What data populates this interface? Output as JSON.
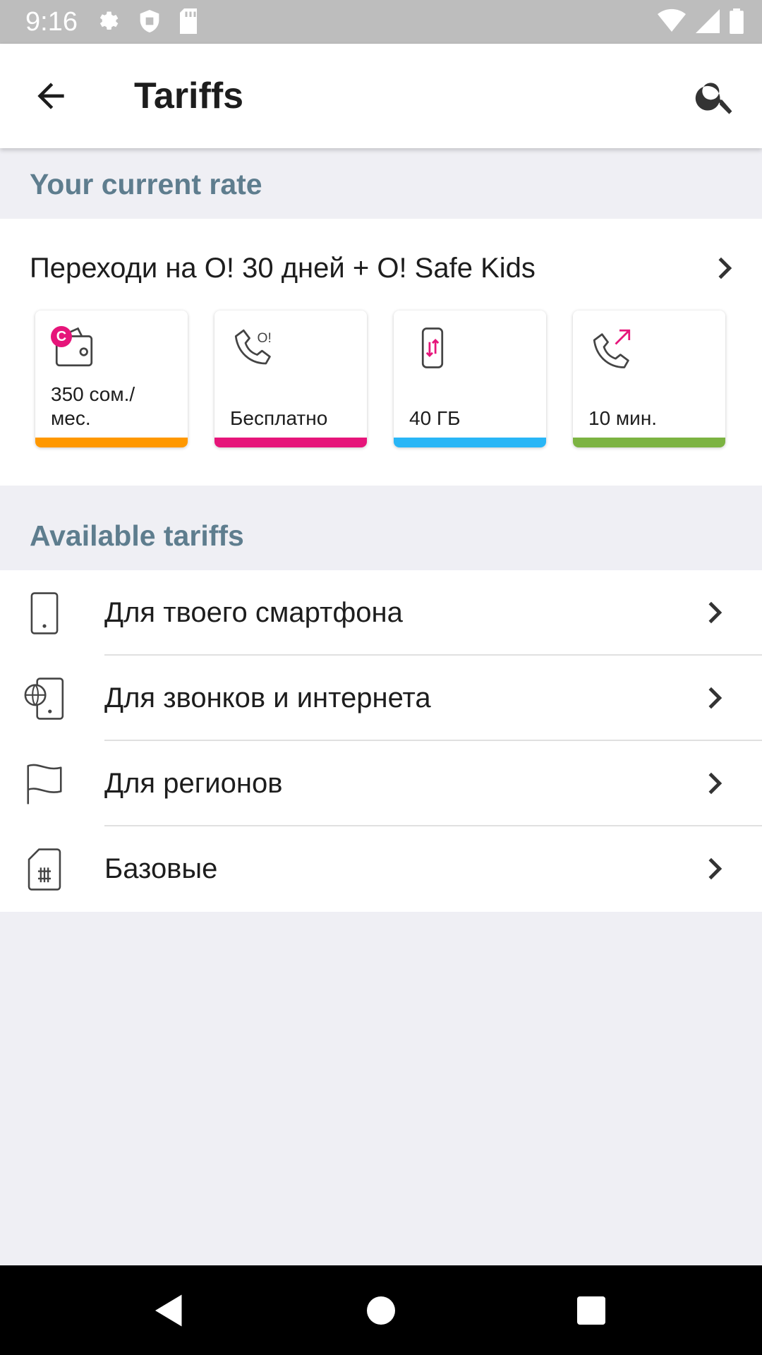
{
  "status_bar": {
    "time": "9:16",
    "icons_left": [
      "settings-icon",
      "shield-icon",
      "sd-card-icon"
    ],
    "icons_right": [
      "wifi-icon",
      "signal-icon",
      "battery-icon"
    ]
  },
  "app_bar": {
    "title": "Tariffs",
    "back_icon": "arrow-back-icon",
    "search_icon": "search-icon"
  },
  "current_rate": {
    "header": "Your current rate",
    "title": "Переходи на О! 30 дней + О! Safe Kids",
    "tiles": [
      {
        "icon": "wallet-icon",
        "badge": "С",
        "label": "350 сом./ мес.",
        "color": "#ff9800"
      },
      {
        "icon": "phone-call-icon",
        "label": "Бесплатно",
        "color": "#e6157a"
      },
      {
        "icon": "phone-data-icon",
        "label": "40 ГБ",
        "color": "#29b6f6"
      },
      {
        "icon": "outgoing-call-icon",
        "label": "10 мин.",
        "color": "#7cb342"
      }
    ]
  },
  "available": {
    "header": "Available tariffs",
    "items": [
      {
        "icon": "smartphone-icon",
        "label": "Для твоего смартфона"
      },
      {
        "icon": "globe-phone-icon",
        "label": "Для звонков и интернета"
      },
      {
        "icon": "flag-icon",
        "label": "Для регионов"
      },
      {
        "icon": "sim-card-icon",
        "label": "Базовые"
      }
    ]
  },
  "colors": {
    "accent": "#e6157a",
    "section_header": "#5e7d8e",
    "background": "#efeff4"
  }
}
